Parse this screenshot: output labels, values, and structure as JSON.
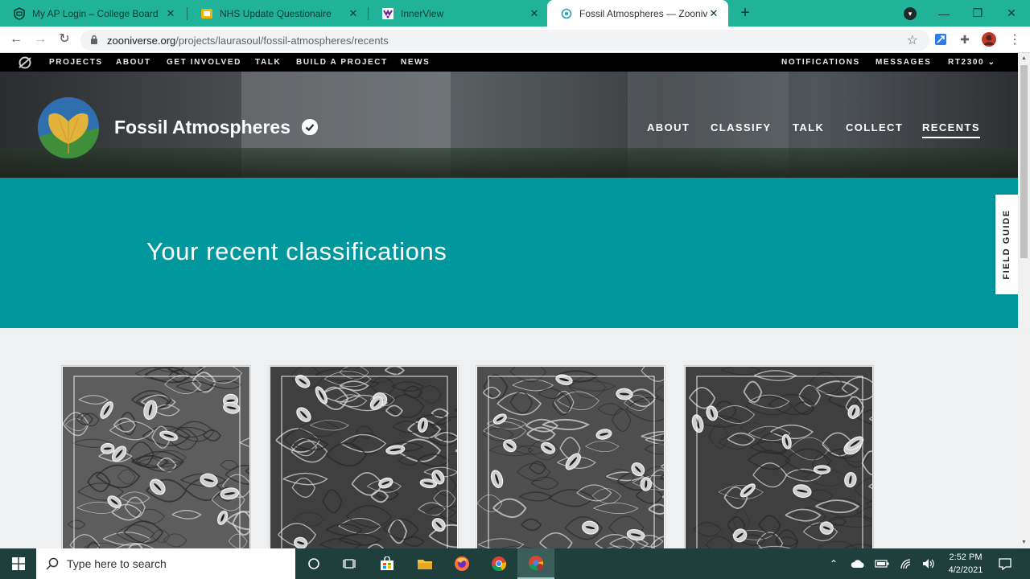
{
  "browser": {
    "tabs": [
      {
        "title": "My AP Login – College Board",
        "icon": "college-board-icon",
        "active": false
      },
      {
        "title": "NHS Update Questionaire",
        "icon": "google-slides-icon",
        "active": false
      },
      {
        "title": "InnerView",
        "icon": "innerview-icon",
        "active": false
      },
      {
        "title": "Fossil Atmospheres — Zoonivers",
        "icon": "zooniverse-icon",
        "active": true
      }
    ],
    "new_tab": "+",
    "url_host": "zooniverse.org",
    "url_path": "/projects/laurasoul/fossil-atmospheres/recents"
  },
  "zooniverse_nav": {
    "left": [
      "PROJECTS",
      "ABOUT",
      "GET INVOLVED",
      "TALK",
      "BUILD A PROJECT",
      "NEWS"
    ],
    "right": [
      "NOTIFICATIONS",
      "MESSAGES"
    ],
    "user": "RT2300"
  },
  "project": {
    "title": "Fossil Atmospheres",
    "nav": [
      "ABOUT",
      "CLASSIFY",
      "TALK",
      "COLLECT",
      "RECENTS"
    ],
    "active_nav": "RECENTS"
  },
  "banner": {
    "heading": "Your recent classifications"
  },
  "field_guide": "FIELD GUIDE",
  "recents": [
    {
      "kind": "stomata-micrograph",
      "tone": "light"
    },
    {
      "kind": "stomata-micrograph",
      "tone": "dark"
    },
    {
      "kind": "stomata-micrograph",
      "tone": "mid"
    },
    {
      "kind": "stomata-micrograph",
      "tone": "dark"
    }
  ],
  "taskbar": {
    "search_placeholder": "Type here to search",
    "time": "2:52 PM",
    "date": "4/2/2021"
  },
  "colors": {
    "tabstrip": "#20b39a",
    "banner": "#00979d",
    "nav_bg": "#000000"
  }
}
